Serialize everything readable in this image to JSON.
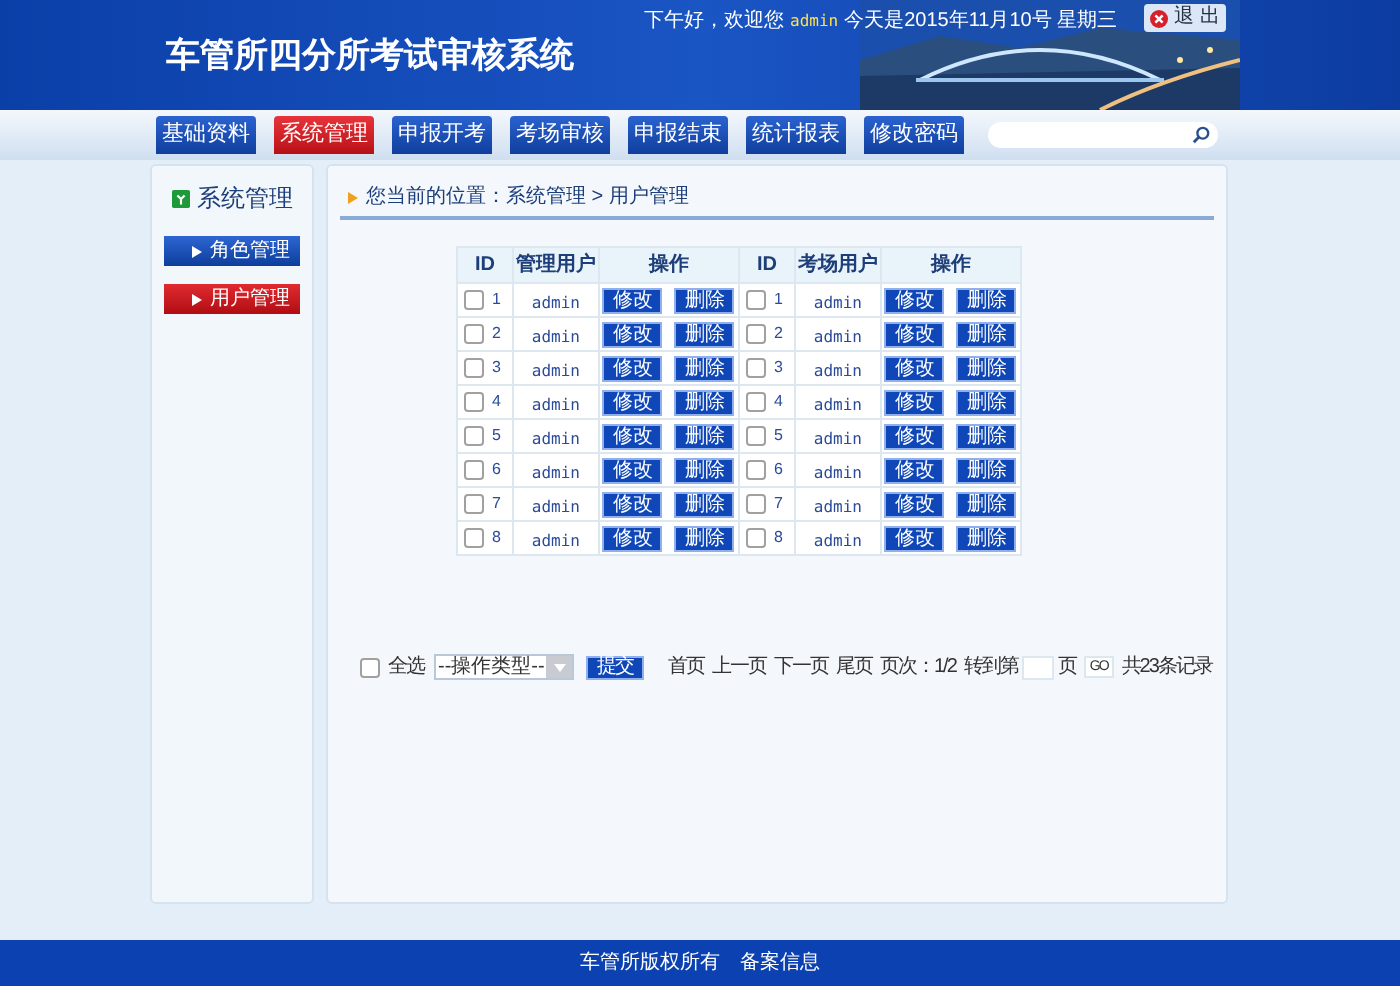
{
  "header": {
    "title": "车管所四分所考试审核系统",
    "greeting": "下午好，欢迎您",
    "user": "admin",
    "date": "今天是2015年11月10号 星期三",
    "logout": "退 出"
  },
  "nav": [
    {
      "label": "基础资料",
      "selected": false
    },
    {
      "label": "系统管理",
      "selected": true
    },
    {
      "label": "申报开考",
      "selected": false
    },
    {
      "label": "考场审核",
      "selected": false
    },
    {
      "label": "申报结束",
      "selected": false
    },
    {
      "label": "统计报表",
      "selected": false
    },
    {
      "label": "修改密码",
      "selected": false
    }
  ],
  "sidebar": {
    "title": "系统管理",
    "items": [
      {
        "label": "角色管理",
        "selected": false
      },
      {
        "label": "用户管理",
        "selected": true
      }
    ]
  },
  "breadcrumb": "您当前的位置：系统管理 > 用户管理",
  "table": {
    "columns": [
      "ID",
      "管理用户",
      "操作",
      "ID",
      "考场用户",
      "操作"
    ],
    "rows": [
      {
        "left": {
          "id": "1",
          "user": "admin",
          "checked": false,
          "edit": "修改",
          "delete": "删除"
        },
        "right": {
          "id": "1",
          "user": "admin",
          "checked": false,
          "edit": "修改",
          "delete": "删除"
        }
      },
      {
        "left": {
          "id": "2",
          "user": "admin",
          "checked": false,
          "edit": "修改",
          "delete": "删除"
        },
        "right": {
          "id": "2",
          "user": "admin",
          "checked": false,
          "edit": "修改",
          "delete": "删除"
        }
      },
      {
        "left": {
          "id": "3",
          "user": "admin",
          "checked": false,
          "edit": "修改",
          "delete": "删除"
        },
        "right": {
          "id": "3",
          "user": "admin",
          "checked": false,
          "edit": "修改",
          "delete": "删除"
        }
      },
      {
        "left": {
          "id": "4",
          "user": "admin",
          "checked": false,
          "edit": "修改",
          "delete": "删除"
        },
        "right": {
          "id": "4",
          "user": "admin",
          "checked": false,
          "edit": "修改",
          "delete": "删除"
        }
      },
      {
        "left": {
          "id": "5",
          "user": "admin",
          "checked": false,
          "edit": "修改",
          "delete": "删除"
        },
        "right": {
          "id": "5",
          "user": "admin",
          "checked": false,
          "edit": "修改",
          "delete": "删除"
        }
      },
      {
        "left": {
          "id": "6",
          "user": "admin",
          "checked": false,
          "edit": "修改",
          "delete": "删除"
        },
        "right": {
          "id": "6",
          "user": "admin",
          "checked": false,
          "edit": "修改",
          "delete": "删除"
        }
      },
      {
        "left": {
          "id": "7",
          "user": "admin",
          "checked": false,
          "edit": "修改",
          "delete": "删除"
        },
        "right": {
          "id": "7",
          "user": "admin",
          "checked": false,
          "edit": "修改",
          "delete": "删除"
        }
      },
      {
        "left": {
          "id": "8",
          "user": "admin",
          "checked": false,
          "edit": "修改",
          "delete": "删除"
        },
        "right": {
          "id": "8",
          "user": "admin",
          "checked": false,
          "edit": "修改",
          "delete": "删除"
        }
      }
    ]
  },
  "footer_bar": {
    "select_all": {
      "label": "全选",
      "checked": false
    },
    "action_select": "--操作类型--",
    "submit": "提交",
    "pager": [
      "首页",
      "上一页",
      "下一页",
      "尾页"
    ],
    "page_info": "页次：1/2",
    "goto_label": "转到第",
    "goto_unit": "页",
    "go": "GO",
    "total": "共23条记录"
  },
  "copyright": "车管所版权所有　备案信息"
}
